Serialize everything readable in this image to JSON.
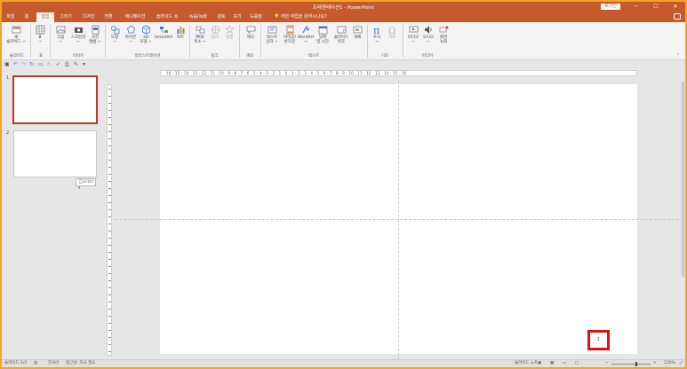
{
  "window": {
    "title": "프레젠테이션1 - PowerPoint",
    "login_label": "로그인",
    "minimize": "─",
    "restore": "☐",
    "close": "✕"
  },
  "tabs": [
    "파일",
    "홈",
    "삽입",
    "그리기",
    "디자인",
    "전환",
    "애니메이션",
    "슬라이드 쇼",
    "녹음/녹화",
    "검토",
    "보기",
    "도움말"
  ],
  "active_tab": "삽입",
  "tell_me": "어떤 작업을 원하시나요?",
  "ribbon": {
    "buttons": [
      {
        "name": "new-slide",
        "label": "새\n슬라이드 ~",
        "icon": "new-slide-icon"
      },
      {
        "name": "table",
        "label": "표\n~",
        "icon": "table-icon"
      },
      {
        "name": "pictures",
        "label": "그림\n~",
        "icon": "picture-icon"
      },
      {
        "name": "screenshot",
        "label": "스크린샷\n~",
        "icon": "screenshot-icon"
      },
      {
        "name": "photo-album",
        "label": "사진\n앨범 ~",
        "icon": "photo-album-icon"
      },
      {
        "name": "shapes",
        "label": "도형\n~",
        "icon": "shapes-icon"
      },
      {
        "name": "icons",
        "label": "아이콘\n~",
        "icon": "icons-icon"
      },
      {
        "name": "3d-models",
        "label": "3D\n모델 ~",
        "icon": "3d-model-icon"
      },
      {
        "name": "smartart",
        "label": "SmartArt",
        "icon": "smartart-icon"
      },
      {
        "name": "chart",
        "label": "차트",
        "icon": "chart-icon"
      },
      {
        "name": "zoom",
        "label": "확대/\n축소 ~",
        "icon": "zoom-icon"
      },
      {
        "name": "link",
        "label": "링크",
        "icon": "link-icon"
      },
      {
        "name": "action",
        "label": "실행",
        "icon": "action-icon"
      },
      {
        "name": "comment",
        "label": "메모",
        "icon": "comment-icon"
      },
      {
        "name": "text-box",
        "label": "텍스트\n상자 ~",
        "icon": "text-box-icon"
      },
      {
        "name": "header-footer",
        "label": "머리글/\n바닥글",
        "icon": "header-footer-icon"
      },
      {
        "name": "wordart",
        "label": "WordArt\n~",
        "icon": "wordart-icon"
      },
      {
        "name": "date-time",
        "label": "날짜\n및 시간",
        "icon": "date-time-icon"
      },
      {
        "name": "slide-number",
        "label": "슬라이드\n번호",
        "icon": "slide-number-icon"
      },
      {
        "name": "object",
        "label": "개체",
        "icon": "object-icon"
      },
      {
        "name": "equation",
        "label": "수식\n~",
        "icon": "equation-icon"
      },
      {
        "name": "symbol",
        "label": "기호",
        "icon": "symbol-icon"
      },
      {
        "name": "video",
        "label": "비디오\n~",
        "icon": "video-icon"
      },
      {
        "name": "audio",
        "label": "오디오\n~",
        "icon": "audio-icon"
      },
      {
        "name": "screen-recording",
        "label": "화면\n녹화",
        "icon": "screen-recording-icon"
      }
    ],
    "groups": [
      "슬라이드",
      "표",
      "이미지",
      "일러스트레이션",
      "링크",
      "메모",
      "텍스트",
      "기호",
      "미디어"
    ]
  },
  "ruler_text": "16 · 15 · 14 · 13 · 12 · 11 · 10 · 9 · 8 · 7 · 6 · 5 · 4 · 3 · 2 · 1 · 0 · 1 · 2 · 3 · 4 · 5 · 6 · 7 · 8 · 9 · 10 · 11 · 12 · 13 · 14 · 15 · 16",
  "thumbnails": [
    {
      "number": "1",
      "selected": true
    },
    {
      "number": "2",
      "selected": false
    }
  ],
  "paste_badge": "(Ctrl) ▾",
  "slide_number_box": "1",
  "status": {
    "slide_count": "슬라이드 1/2",
    "language": "한국어",
    "accessibility": "접근성: 조사 필요",
    "notes": "슬라이드 노트",
    "zoom": "120%"
  },
  "colors": {
    "accent": "#c65a2c",
    "highlight_border": "#e11010",
    "frame": "#f4a428"
  }
}
